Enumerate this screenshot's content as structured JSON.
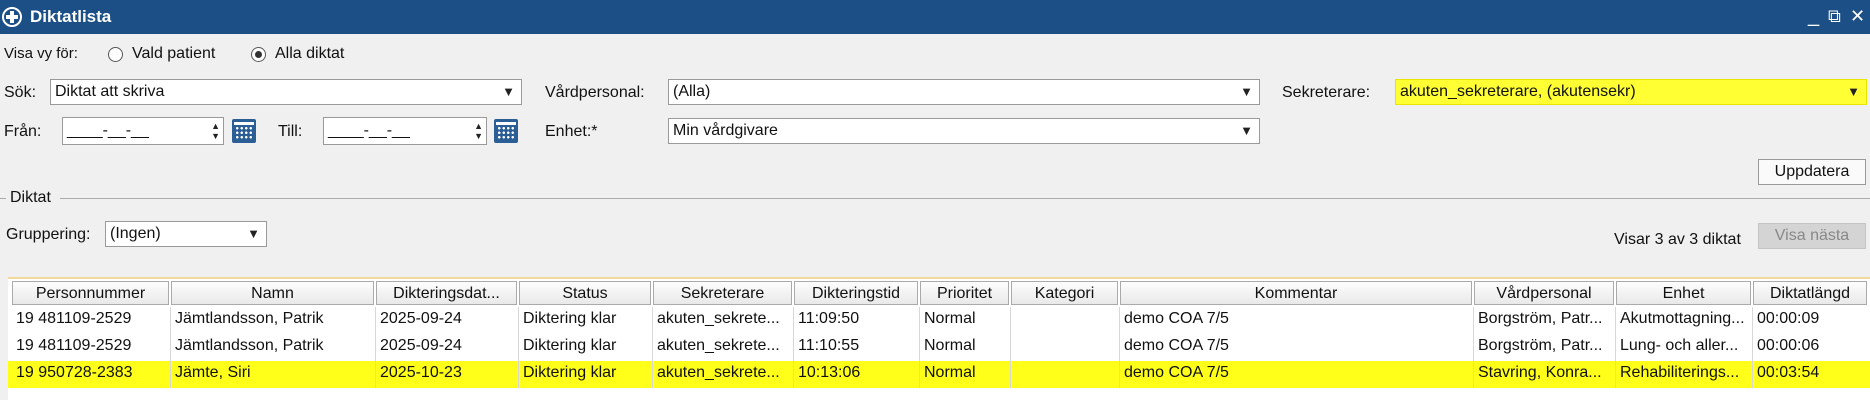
{
  "window": {
    "title": "Diktatlista",
    "controls": [
      "_",
      "⧉",
      "✕"
    ]
  },
  "view": {
    "label": "Visa vy för:",
    "options": [
      {
        "label": "Vald patient",
        "checked": false
      },
      {
        "label": "Alla diktat",
        "checked": true
      }
    ]
  },
  "filters": {
    "search_label": "Sök:",
    "search_value": "Diktat att skriva",
    "vardpersonal_label": "Vårdpersonal:",
    "vardpersonal_value": "(Alla)",
    "sekreterare_label": "Sekreterare:",
    "sekreterare_value": "akuten_sekreterare, (akutensekr)",
    "from_label": "Från:",
    "from_value": "____-__-__",
    "to_label": "Till:",
    "to_value": "____-__-__",
    "enhet_label": "Enhet:*",
    "enhet_value": "Min vårdgivare"
  },
  "buttons": {
    "update": "Uppdatera",
    "show_next": "Visa nästa"
  },
  "section": {
    "title": "Diktat",
    "grouping_label": "Gruppering:",
    "grouping_value": "(Ingen)",
    "count_text": "Visar 3 av 3 diktat"
  },
  "table": {
    "columns": [
      "Personnummer",
      "Namn",
      "Dikteringsdat...",
      "Status",
      "Sekreterare",
      "Dikteringstid",
      "Prioritet",
      "Kategori",
      "Kommentar",
      "Vårdpersonal",
      "Enhet",
      "Diktatlängd"
    ],
    "rows": [
      {
        "personnummer": "19 481109-2529",
        "namn": "Jämtlandsson, Patrik",
        "datum": "2025-09-24",
        "status": "Diktering klar",
        "sekreterare": "akuten_sekrete...",
        "tid": "11:09:50",
        "prioritet": "Normal",
        "kategori": "",
        "kommentar": "demo COA 7/5",
        "vardpersonal": "Borgström, Patr...",
        "enhet": "Akutmottagning...",
        "langd": "00:00:09",
        "selected": false
      },
      {
        "personnummer": "19 481109-2529",
        "namn": "Jämtlandsson, Patrik",
        "datum": "2025-09-24",
        "status": "Diktering klar",
        "sekreterare": "akuten_sekrete...",
        "tid": "11:10:55",
        "prioritet": "Normal",
        "kategori": "",
        "kommentar": "demo COA 7/5",
        "vardpersonal": "Borgström, Patr...",
        "enhet": "Lung- och aller...",
        "langd": "00:00:06",
        "selected": false
      },
      {
        "personnummer": "19 950728-2383",
        "namn": "Jämte, Siri",
        "datum": "2025-10-23",
        "status": "Diktering klar",
        "sekreterare": "akuten_sekrete...",
        "tid": "10:13:06",
        "prioritet": "Normal",
        "kategori": "",
        "kommentar": "demo COA 7/5",
        "vardpersonal": "Stavring, Konra...",
        "enhet": "Rehabiliterings...",
        "langd": "00:03:54",
        "selected": true
      }
    ]
  },
  "colors": {
    "titlebar": "#1c4f86",
    "highlight": "#ffff1a"
  }
}
